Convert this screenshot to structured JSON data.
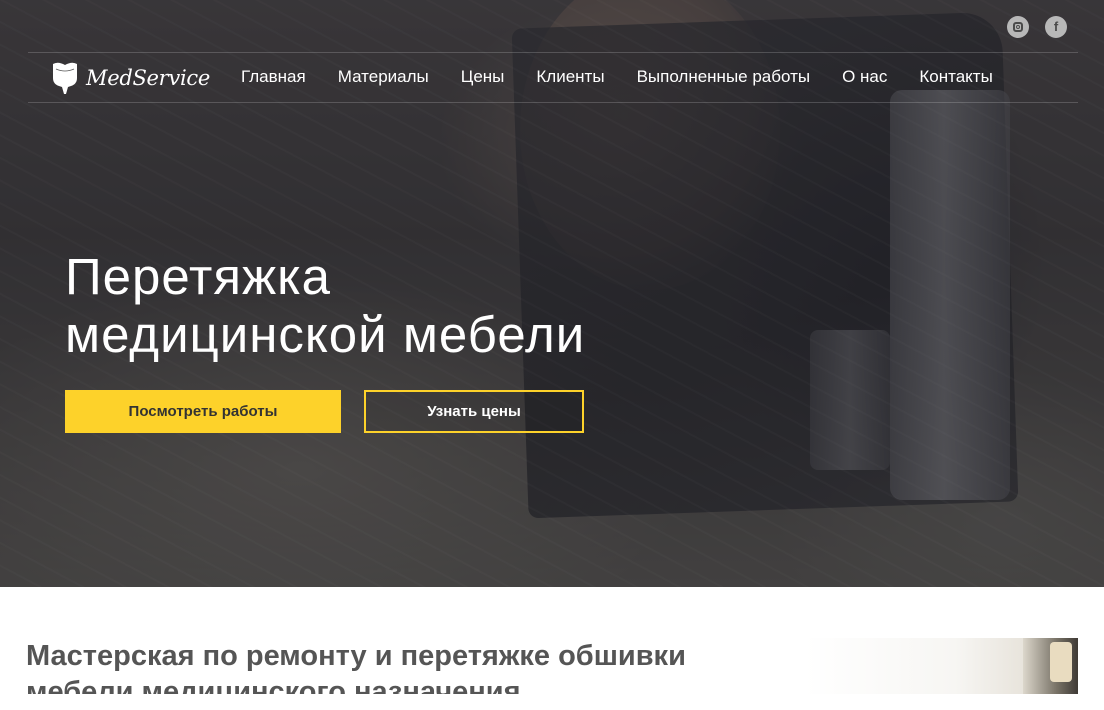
{
  "brand": {
    "name": "MedService"
  },
  "social": {
    "instagram": "instagram-icon",
    "facebook": "facebook-icon",
    "facebook_glyph": "f"
  },
  "nav": {
    "items": [
      {
        "label": "Главная"
      },
      {
        "label": "Материалы"
      },
      {
        "label": "Цены"
      },
      {
        "label": "Клиенты"
      },
      {
        "label": "Выполненные работы"
      },
      {
        "label": "О нас"
      },
      {
        "label": "Контакты"
      }
    ]
  },
  "hero": {
    "title_line1": "Перетяжка",
    "title_line2": "медицинской мебели",
    "primary_button": "Посмотреть работы",
    "secondary_button": "Узнать цены"
  },
  "section": {
    "title": "Мастерская по ремонту и перетяжке обшивки мебели медицинского назначения"
  },
  "colors": {
    "accent": "#fdd22a",
    "heading": "#555555"
  }
}
